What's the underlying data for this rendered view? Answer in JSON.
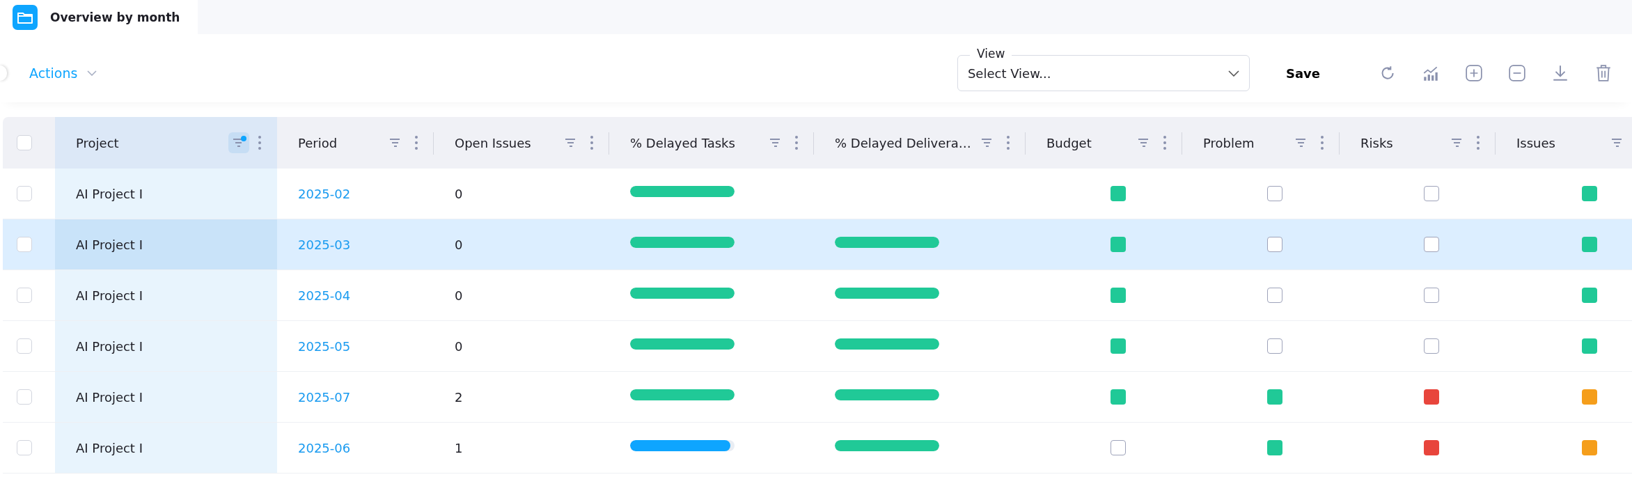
{
  "tab": {
    "label": "Overview by month"
  },
  "toolbar": {
    "actions": "Actions",
    "view": {
      "label": "View",
      "placeholder": "Select View..."
    },
    "save": "Save"
  },
  "table": {
    "all_checked": false,
    "columns": [
      {
        "label": "Project",
        "filtered": true
      },
      {
        "label": "Period",
        "filtered": false
      },
      {
        "label": "Open Issues",
        "filtered": false
      },
      {
        "label": "% Delayed Tasks",
        "filtered": false
      },
      {
        "label": "% Delayed Delivera…",
        "filtered": false
      },
      {
        "label": "Budget",
        "filtered": false
      },
      {
        "label": "Problem",
        "filtered": false
      },
      {
        "label": "Risks",
        "filtered": false
      },
      {
        "label": "Issues",
        "filtered": false
      }
    ],
    "rows": [
      {
        "selected": false,
        "checked": false,
        "project": "AI Project I",
        "period": "2025-02",
        "open_issues": "0",
        "delayed_tasks": {
          "level": 1,
          "color": "#20c997"
        },
        "statuses": [
          {
            "kind": "filled",
            "color": "#20c997"
          },
          {
            "kind": "empty"
          },
          {
            "kind": "empty"
          },
          {
            "kind": "filled",
            "color": "#20c997"
          }
        ]
      },
      {
        "selected": true,
        "checked": false,
        "project": "AI Project I",
        "period": "2025-03",
        "open_issues": "0",
        "delayed_tasks": {
          "level": 1,
          "color": "#20c997"
        },
        "delayed_deliverables": {
          "level": 1,
          "color": "#20c997"
        },
        "statuses": [
          {
            "kind": "filled",
            "color": "#20c997"
          },
          {
            "kind": "empty"
          },
          {
            "kind": "empty"
          },
          {
            "kind": "filled",
            "color": "#20c997"
          }
        ]
      },
      {
        "selected": false,
        "checked": false,
        "project": "AI Project I",
        "period": "2025-04",
        "open_issues": "0",
        "delayed_tasks": {
          "level": 1,
          "color": "#20c997"
        },
        "delayed_deliverables": {
          "level": 1,
          "color": "#20c997"
        },
        "statuses": [
          {
            "kind": "filled",
            "color": "#20c997"
          },
          {
            "kind": "empty"
          },
          {
            "kind": "empty"
          },
          {
            "kind": "filled",
            "color": "#20c997"
          }
        ]
      },
      {
        "selected": false,
        "checked": false,
        "project": "AI Project I",
        "period": "2025-05",
        "open_issues": "0",
        "delayed_tasks": {
          "level": 1,
          "color": "#20c997"
        },
        "delayed_deliverables": {
          "level": 1,
          "color": "#20c997"
        },
        "statuses": [
          {
            "kind": "filled",
            "color": "#20c997"
          },
          {
            "kind": "empty"
          },
          {
            "kind": "empty"
          },
          {
            "kind": "filled",
            "color": "#20c997"
          }
        ]
      },
      {
        "selected": false,
        "checked": false,
        "project": "AI Project I",
        "period": "2025-07",
        "open_issues": "2",
        "delayed_tasks": {
          "level": 1,
          "color": "#20c997"
        },
        "delayed_deliverables": {
          "level": 1,
          "color": "#20c997"
        },
        "statuses": [
          {
            "kind": "filled",
            "color": "#20c997"
          },
          {
            "kind": "filled",
            "color": "#20c997"
          },
          {
            "kind": "filled",
            "color": "#e8453c"
          },
          {
            "kind": "filled",
            "color": "#f59e1b"
          }
        ]
      },
      {
        "selected": false,
        "checked": false,
        "project": "AI Project I",
        "period": "2025-06",
        "open_issues": "1",
        "delayed_tasks": {
          "level": 0.96,
          "color": "#0ea5ff"
        },
        "delayed_deliverables": {
          "level": 1,
          "color": "#20c997"
        },
        "statuses": [
          {
            "kind": "empty"
          },
          {
            "kind": "filled",
            "color": "#20c997"
          },
          {
            "kind": "filled",
            "color": "#e8453c"
          },
          {
            "kind": "filled",
            "color": "#f59e1b"
          }
        ]
      }
    ]
  }
}
